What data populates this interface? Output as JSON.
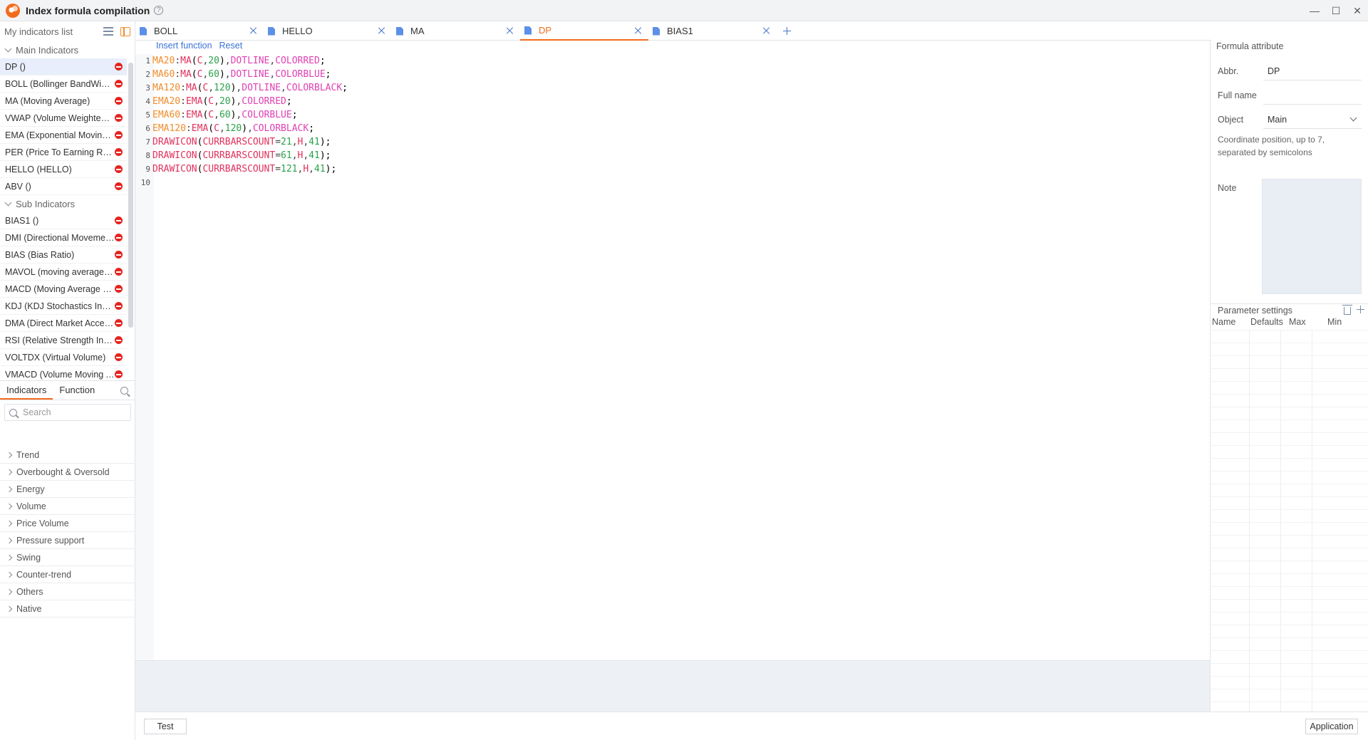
{
  "window": {
    "title": "Index formula compilation",
    "help_glyph": "?",
    "controls": {
      "minimize": "—",
      "maximize": "☐",
      "close": "✕"
    }
  },
  "left_panel": {
    "header_label": "My indicators list",
    "groups": [
      {
        "name": "Main Indicators",
        "items": [
          "DP ()",
          "BOLL (Bollinger BandWidth)",
          "MA (Moving Average)",
          "VWAP (Volume Weighted Average Price)",
          "EMA (Exponential Moving Average)",
          "PER (Price To Earning Ratio)",
          "HELLO (HELLO)",
          "ABV ()"
        ]
      },
      {
        "name": "Sub Indicators",
        "items": [
          "BIAS1 ()",
          "DMI (Directional Movement Index)",
          "BIAS (Bias Ratio)",
          "MAVOL (moving average volume)",
          "MACD (Moving Average Convergence Divergence)",
          "KDJ (KDJ Stochastics Indicator)",
          "DMA (Direct Market Access)",
          "RSI (Relative Strength Index)",
          "VOLTDX (Virtual Volume)",
          "VMACD (Volume Moving Average)"
        ]
      }
    ],
    "selected_item": "DP ()",
    "lower_tabs": [
      "Indicators",
      "Function"
    ],
    "search_placeholder": "Search",
    "categories": [
      "Trend",
      "Overbought & Oversold",
      "Energy",
      "Volume",
      "Price Volume",
      "Pressure support",
      "Swing",
      "Counter-trend",
      "Others",
      "Native"
    ]
  },
  "tabs": [
    {
      "label": "BOLL",
      "active": false
    },
    {
      "label": "HELLO",
      "active": false
    },
    {
      "label": "MA",
      "active": false
    },
    {
      "label": "DP",
      "active": true
    },
    {
      "label": "BIAS1",
      "active": false
    }
  ],
  "editor": {
    "toolbar": {
      "insert_function": "Insert function",
      "reset": "Reset"
    },
    "lines": [
      [
        [
          "name",
          "MA20"
        ],
        [
          "op",
          ":"
        ],
        [
          "fn",
          "MA"
        ],
        [
          "ink",
          "("
        ],
        [
          "var",
          "C"
        ],
        [
          "op",
          ","
        ],
        [
          "num",
          "20"
        ],
        [
          "ink",
          ")"
        ],
        [
          "op",
          ","
        ],
        [
          "kw",
          "DOTLINE"
        ],
        [
          "op",
          ","
        ],
        [
          "kw",
          "COLORRED"
        ],
        [
          "ink",
          ";"
        ]
      ],
      [
        [
          "name",
          "MA60"
        ],
        [
          "op",
          ":"
        ],
        [
          "fn",
          "MA"
        ],
        [
          "ink",
          "("
        ],
        [
          "var",
          "C"
        ],
        [
          "op",
          ","
        ],
        [
          "num",
          "60"
        ],
        [
          "ink",
          ")"
        ],
        [
          "op",
          ","
        ],
        [
          "kw",
          "DOTLINE"
        ],
        [
          "op",
          ","
        ],
        [
          "kw",
          "COLORBLUE"
        ],
        [
          "ink",
          ";"
        ]
      ],
      [
        [
          "name",
          "MA120"
        ],
        [
          "op",
          ":"
        ],
        [
          "fn",
          "MA"
        ],
        [
          "ink",
          "("
        ],
        [
          "var",
          "C"
        ],
        [
          "op",
          ","
        ],
        [
          "num",
          "120"
        ],
        [
          "ink",
          ")"
        ],
        [
          "op",
          ","
        ],
        [
          "kw",
          "DOTLINE"
        ],
        [
          "op",
          ","
        ],
        [
          "kw",
          "COLORBLACK"
        ],
        [
          "ink",
          ";"
        ]
      ],
      [
        [
          "name",
          "EMA20"
        ],
        [
          "op",
          ":"
        ],
        [
          "fn",
          "EMA"
        ],
        [
          "ink",
          "("
        ],
        [
          "var",
          "C"
        ],
        [
          "op",
          ","
        ],
        [
          "num",
          "20"
        ],
        [
          "ink",
          ")"
        ],
        [
          "op",
          ","
        ],
        [
          "kw",
          "COLORRED"
        ],
        [
          "ink",
          ";"
        ]
      ],
      [
        [
          "name",
          "EMA60"
        ],
        [
          "op",
          ":"
        ],
        [
          "fn",
          "EMA"
        ],
        [
          "ink",
          "("
        ],
        [
          "var",
          "C"
        ],
        [
          "op",
          ","
        ],
        [
          "num",
          "60"
        ],
        [
          "ink",
          ")"
        ],
        [
          "op",
          ","
        ],
        [
          "kw",
          "COLORBLUE"
        ],
        [
          "ink",
          ";"
        ]
      ],
      [
        [
          "name",
          "EMA120"
        ],
        [
          "op",
          ":"
        ],
        [
          "fn",
          "EMA"
        ],
        [
          "ink",
          "("
        ],
        [
          "var",
          "C"
        ],
        [
          "op",
          ","
        ],
        [
          "num",
          "120"
        ],
        [
          "ink",
          ")"
        ],
        [
          "op",
          ","
        ],
        [
          "kw",
          "COLORBLACK"
        ],
        [
          "ink",
          ";"
        ]
      ],
      [
        [
          "kwr",
          "DRAWICON"
        ],
        [
          "ink",
          "("
        ],
        [
          "kwr",
          "CURRBARSCOUNT"
        ],
        [
          "op",
          "="
        ],
        [
          "num",
          "21"
        ],
        [
          "op",
          ","
        ],
        [
          "var",
          "H"
        ],
        [
          "op",
          ","
        ],
        [
          "num",
          "41"
        ],
        [
          "ink",
          ");"
        ]
      ],
      [
        [
          "kwr",
          "DRAWICON"
        ],
        [
          "ink",
          "("
        ],
        [
          "kwr",
          "CURRBARSCOUNT"
        ],
        [
          "op",
          "="
        ],
        [
          "num",
          "61"
        ],
        [
          "op",
          ","
        ],
        [
          "var",
          "H"
        ],
        [
          "op",
          ","
        ],
        [
          "num",
          "41"
        ],
        [
          "ink",
          ");"
        ]
      ],
      [
        [
          "kwr",
          "DRAWICON"
        ],
        [
          "ink",
          "("
        ],
        [
          "kwr",
          "CURRBARSCOUNT"
        ],
        [
          "op",
          "="
        ],
        [
          "num",
          "121"
        ],
        [
          "op",
          ","
        ],
        [
          "var",
          "H"
        ],
        [
          "op",
          ","
        ],
        [
          "num",
          "41"
        ],
        [
          "ink",
          ");"
        ]
      ],
      []
    ]
  },
  "attributes": {
    "title": "Formula attribute",
    "abbr_label": "Abbr.",
    "abbr_value": "DP",
    "fullname_label": "Full name",
    "fullname_value": "",
    "object_label": "Object",
    "object_value": "Main",
    "coord_hint": "Coordinate position, up to 7, separated by semicolons",
    "note_label": "Note",
    "params_title": "Parameter settings",
    "param_columns": [
      "Name",
      "Defaults",
      "Max",
      "Min"
    ]
  },
  "buttons": {
    "test": "Test",
    "apply": "Application"
  },
  "colors": {
    "accent": "#f26b1d",
    "link": "#3a73d8",
    "delete": "#e52420"
  }
}
